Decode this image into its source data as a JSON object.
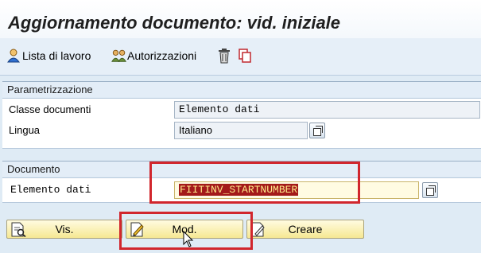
{
  "window": {
    "title": "Aggiornamento documento: vid. iniziale"
  },
  "toolbar": {
    "worklist_label": "Lista di lavoro",
    "authorizations_label": "Autorizzazioni"
  },
  "parametrizzazione": {
    "header": "Parametrizzazione",
    "doc_class_label": "Classe documenti",
    "doc_class_value": "Elemento dati",
    "language_label": "Lingua",
    "language_value": "Italiano"
  },
  "documento": {
    "header": "Documento",
    "element_label": "Elemento dati",
    "element_value": "FIITINV_STARTNUMBER"
  },
  "actions": {
    "display_label": "Vis.",
    "change_label": "Mod.",
    "create_label": "Creare"
  },
  "colors": {
    "highlight": "#d1262d",
    "field_selection": "#a31a1a",
    "button_yellow": "#f6e892"
  }
}
